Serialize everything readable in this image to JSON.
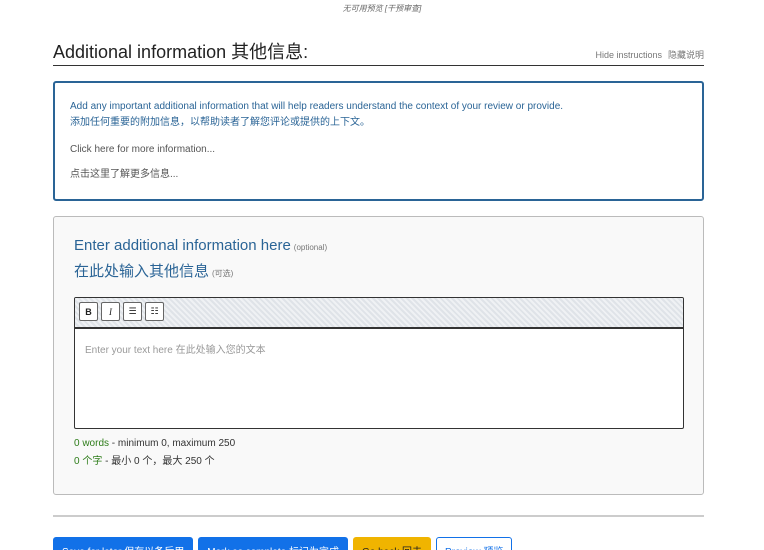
{
  "top_note": "无可用预览 [干预审查]",
  "header": {
    "title": "Additional information  其他信息:",
    "hide_instructions_en": "Hide instructions",
    "hide_instructions_zh": "隐藏说明"
  },
  "instructions": {
    "line_en": "Add any important additional information that will help readers understand the context of your review or provide.",
    "line_zh": "添加任何重要的附加信息，以帮助读者了解您评论或提供的上下文。",
    "link_en": "Click here for more information...",
    "link_zh": "点击这里了解更多信息..."
  },
  "field": {
    "label_en": "Enter additional information here",
    "label_zh": "在此处输入其他信息",
    "optional_en": "(optional)",
    "optional_zh": "(可选)",
    "placeholder": "Enter your text here  在此处输入您的文本"
  },
  "toolbar": {
    "bold": "B",
    "italic": "I",
    "bullet_list": "☰",
    "numbered_list": "☷"
  },
  "counts": {
    "words_en": "0 words",
    "limits_en": " - minimum 0, maximum 250",
    "words_zh": "0 个字",
    "limits_zh": " - 最小 0 个，最大 250 个"
  },
  "buttons": {
    "save_later": "Save for later  保存以备后用",
    "mark_complete": "Mark as complete  标记为完成",
    "go_back": "Go back  回去",
    "preview": "Preview  预览"
  },
  "colors": {
    "accent": "#2a6496",
    "primary_button": "#1271e8",
    "warning_button": "#f0b400",
    "count_green": "#2e7d1a"
  }
}
